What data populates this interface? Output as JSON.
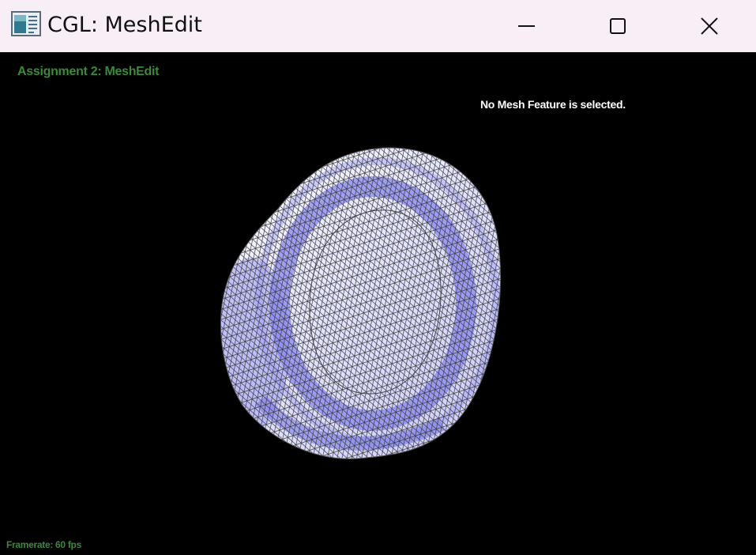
{
  "window": {
    "title": "CGL: MeshEdit",
    "controls": [
      "minimize",
      "maximize",
      "close"
    ],
    "icon": "app-window-icon"
  },
  "hud": {
    "assignment_title": "Assignment 2: MeshEdit",
    "selection_status": "No Mesh Feature is selected.",
    "framerate": "Framerate: 60 fps"
  },
  "scene": {
    "object": "torus-like mesh",
    "wireframe": true,
    "colors": {
      "background": "#000000",
      "mesh_light": "#f2f2ff",
      "mesh_mid": "#b8b8f8",
      "mesh_shadow": "#8a8af0",
      "wire": "#3a3a3a",
      "hud_green": "#3a8a3a",
      "titlebar": "#f8eef6"
    }
  }
}
